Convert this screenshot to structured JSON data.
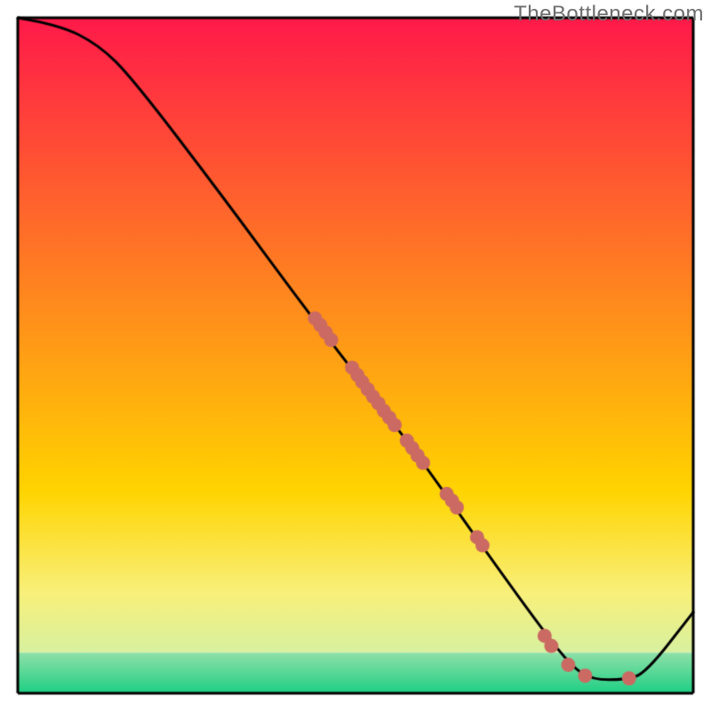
{
  "attribution": "TheBottleneck.com",
  "colors": {
    "top": "#ff1a4a",
    "mid_upper": "#ff7a2a",
    "mid": "#ffd400",
    "mid_lower": "#f9f07a",
    "low": "#d8f0a0",
    "bottom": "#1ecf84",
    "line": "#000000",
    "marker": "#cb6a62",
    "frame": "#000000"
  },
  "chart_data": {
    "type": "line",
    "title": "",
    "xlabel": "",
    "ylabel": "",
    "xlim": [
      0,
      100
    ],
    "ylim": [
      0,
      100
    ],
    "grid": false,
    "legend": false,
    "curve": [
      {
        "x": 0,
        "y": 100
      },
      {
        "x": 6,
        "y": 99
      },
      {
        "x": 12,
        "y": 96
      },
      {
        "x": 17,
        "y": 91
      },
      {
        "x": 30,
        "y": 74
      },
      {
        "x": 44,
        "y": 55
      },
      {
        "x": 58,
        "y": 37
      },
      {
        "x": 70,
        "y": 20
      },
      {
        "x": 78,
        "y": 9
      },
      {
        "x": 82,
        "y": 4
      },
      {
        "x": 85,
        "y": 2
      },
      {
        "x": 90,
        "y": 2
      },
      {
        "x": 93,
        "y": 3
      },
      {
        "x": 100,
        "y": 12
      }
    ],
    "markers": [
      {
        "x": 44.0,
        "y": 55.5
      },
      {
        "x": 44.8,
        "y": 54.5
      },
      {
        "x": 45.6,
        "y": 53.4
      },
      {
        "x": 46.4,
        "y": 52.3
      },
      {
        "x": 49.5,
        "y": 48.2
      },
      {
        "x": 50.3,
        "y": 47.1
      },
      {
        "x": 51.0,
        "y": 46.1
      },
      {
        "x": 51.8,
        "y": 45.0
      },
      {
        "x": 52.6,
        "y": 43.9
      },
      {
        "x": 53.4,
        "y": 42.9
      },
      {
        "x": 54.2,
        "y": 41.8
      },
      {
        "x": 55.0,
        "y": 40.8
      },
      {
        "x": 55.8,
        "y": 39.7
      },
      {
        "x": 57.6,
        "y": 37.4
      },
      {
        "x": 58.4,
        "y": 36.3
      },
      {
        "x": 59.2,
        "y": 35.2
      },
      {
        "x": 60.0,
        "y": 34.1
      },
      {
        "x": 63.5,
        "y": 29.5
      },
      {
        "x": 64.3,
        "y": 28.5
      },
      {
        "x": 65.0,
        "y": 27.5
      },
      {
        "x": 68.0,
        "y": 23.1
      },
      {
        "x": 68.8,
        "y": 21.9
      },
      {
        "x": 78.0,
        "y": 8.5
      },
      {
        "x": 79.0,
        "y": 7.0
      },
      {
        "x": 81.5,
        "y": 4.2
      },
      {
        "x": 84.0,
        "y": 2.6
      },
      {
        "x": 90.5,
        "y": 2.2
      }
    ],
    "gradient_bands": [
      {
        "y0": 100,
        "y1": 30,
        "c0": "#ff1a4a",
        "c1": "#ffd400"
      },
      {
        "y0": 30,
        "y1": 15,
        "c0": "#ffd400",
        "c1": "#f9f07a"
      },
      {
        "y0": 15,
        "y1": 6,
        "c0": "#f9f07a",
        "c1": "#d8f0a0"
      },
      {
        "y0": 6,
        "y1": 0,
        "c0": "#8fe0a8",
        "c1": "#1ecf84"
      }
    ]
  }
}
